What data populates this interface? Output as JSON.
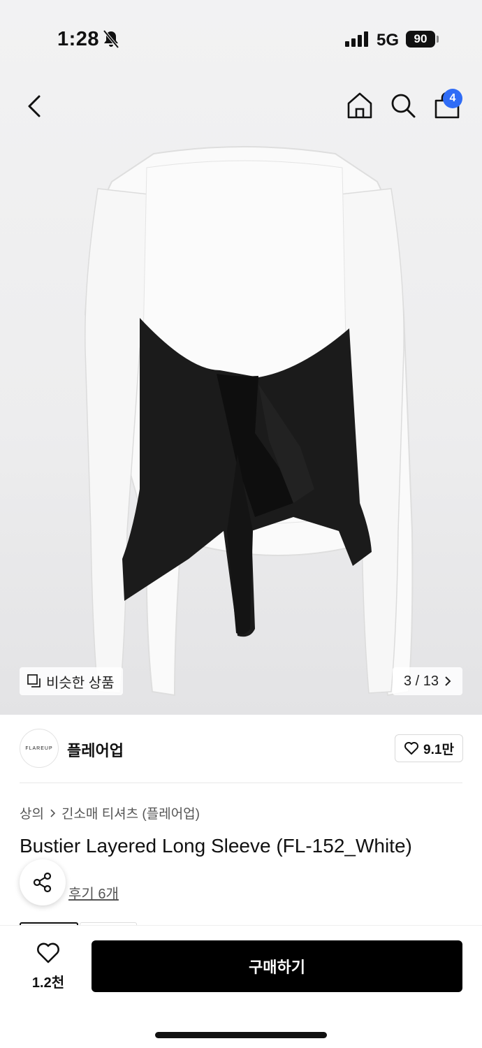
{
  "status": {
    "time": "1:28",
    "network": "5G",
    "battery": "90"
  },
  "nav": {
    "cart_badge": "4"
  },
  "gallery": {
    "similar_label": "비슷한 상품",
    "page_indicator": "3 / 13"
  },
  "brand": {
    "name": "플레어업",
    "logo_text": "FLAREUP",
    "likes": "9.1만"
  },
  "product": {
    "breadcrumb": [
      "상의",
      "긴소매 티셔츠 (플레어업)"
    ],
    "title": "Bustier Layered Long Sleeve (FL-152_White)",
    "reviews_label": "후기 6개"
  },
  "bottom": {
    "wish_count": "1.2천",
    "buy_label": "구매하기"
  },
  "colors": {
    "accent_badge": "#2f6cf6",
    "buy_button": "#000000"
  },
  "icons": [
    "back-icon",
    "home-icon",
    "search-icon",
    "bag-icon",
    "similar-icon",
    "chevron-right-icon",
    "heart-icon",
    "share-icon"
  ]
}
